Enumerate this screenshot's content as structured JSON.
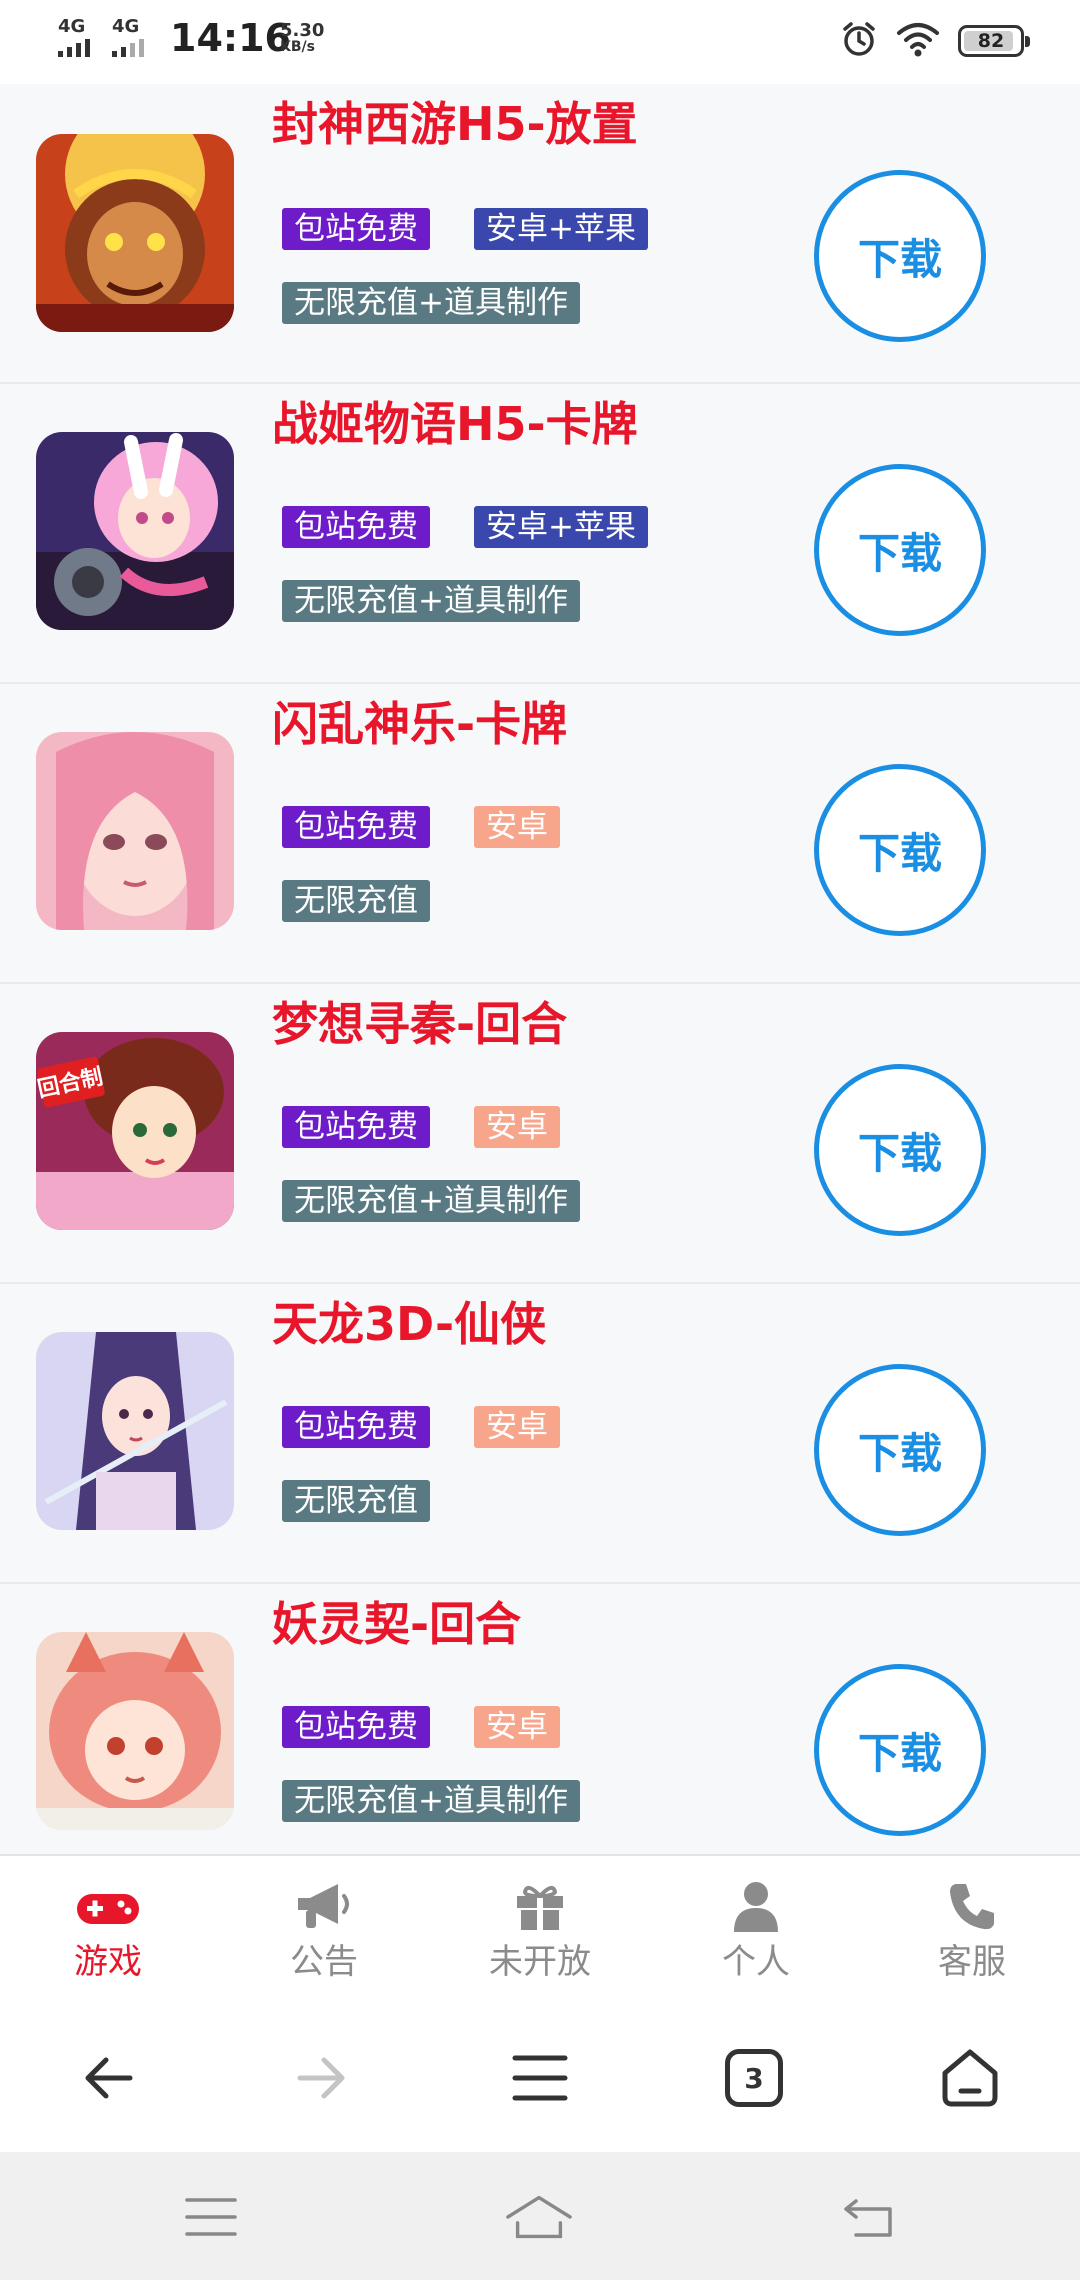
{
  "status_bar": {
    "sim1": "4G",
    "sim2": "4G",
    "time": "14:16",
    "speed_value": "5.30",
    "speed_unit": "KB/s",
    "battery": "82",
    "icons": [
      "alarm-icon",
      "wifi-icon",
      "battery-icon"
    ]
  },
  "games": [
    {
      "title": "封神西游H5-放置",
      "tag_free": "包站免费",
      "tag_platform": "安卓+苹果",
      "platform_kind": "both",
      "tag_feature": "无限充值+道具制作",
      "button": "下载"
    },
    {
      "title": "战姬物语H5-卡牌",
      "tag_free": "包站免费",
      "tag_platform": "安卓+苹果",
      "platform_kind": "both",
      "tag_feature": "无限充值+道具制作",
      "button": "下载"
    },
    {
      "title": "闪乱神乐-卡牌",
      "tag_free": "包站免费",
      "tag_platform": "安卓",
      "platform_kind": "android",
      "tag_feature": "无限充值",
      "button": "下载"
    },
    {
      "title": "梦想寻秦-回合",
      "tag_free": "包站免费",
      "tag_platform": "安卓",
      "platform_kind": "android",
      "tag_feature": "无限充值+道具制作",
      "button": "下载",
      "icon_badge": "回合制"
    },
    {
      "title": "天龙3D-仙侠",
      "tag_free": "包站免费",
      "tag_platform": "安卓",
      "platform_kind": "android",
      "tag_feature": "无限充值",
      "button": "下载"
    },
    {
      "title": "妖灵契-回合",
      "tag_free": "包站免费",
      "tag_platform": "安卓",
      "platform_kind": "android",
      "tag_feature": "无限充值+道具制作",
      "button": "下载"
    }
  ],
  "tabs": [
    {
      "label": "游戏",
      "icon": "gamepad-icon",
      "active": true
    },
    {
      "label": "公告",
      "icon": "megaphone-icon",
      "active": false
    },
    {
      "label": "未开放",
      "icon": "gift-icon",
      "active": false
    },
    {
      "label": "个人",
      "icon": "person-icon",
      "active": false
    },
    {
      "label": "客服",
      "icon": "phone-icon",
      "active": false
    }
  ],
  "browser": {
    "tab_count": "3",
    "icons": [
      "back-arrow-icon",
      "forward-arrow-icon",
      "menu-icon",
      "tabs-icon",
      "home-icon"
    ]
  },
  "system_nav": {
    "icons": [
      "recents-icon",
      "home-icon",
      "back-icon"
    ]
  },
  "colors": {
    "title_red": "#e8162b",
    "tag_free": "#6e1bc9",
    "tag_both": "#3a48ad",
    "tag_android": "#f7a58b",
    "tag_feature": "#5a7a83",
    "download_blue": "#1a8ee3",
    "tab_active": "#e8162b",
    "tab_inactive": "#8b8b8b"
  }
}
